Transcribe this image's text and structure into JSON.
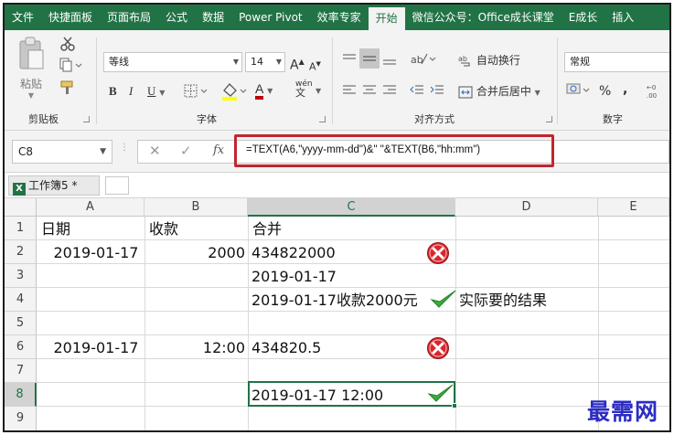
{
  "menu": {
    "tabs": [
      "文件",
      "快捷面板",
      "页面布局",
      "公式",
      "数据",
      "Power Pivot",
      "效率专家",
      "开始",
      "微信公众号：Office成长课堂",
      "E成长",
      "插入"
    ],
    "active_tab": "开始"
  },
  "ribbon": {
    "clipboard": {
      "paste_label": "粘贴",
      "group_label": "剪贴板"
    },
    "font": {
      "font_name": "等线",
      "font_size": "14",
      "grow": "A",
      "shrink": "A",
      "bold": "B",
      "italic": "I",
      "underline": "U",
      "pinyin": "wén",
      "group_label": "字体",
      "font_color": "#c00000",
      "highlight_color": "#ffff00"
    },
    "alignment": {
      "wrap_text": "自动换行",
      "merge_center": "合并后居中",
      "group_label": "对齐方式"
    },
    "number": {
      "format": "常规",
      "percent": "%",
      "comma": ",",
      "group_label": "数字"
    }
  },
  "formula_bar": {
    "name_box": "C8",
    "cancel": "✕",
    "enter": "✓",
    "fx": "fx",
    "formula": "=TEXT(A6,\"yyyy-mm-dd\")&\" \"&TEXT(B6,\"hh:mm\")",
    "highlight_color": "#c0272d"
  },
  "workbook": {
    "tab_label": "工作簿5 *",
    "icon": "X"
  },
  "grid": {
    "columns": [
      "A",
      "B",
      "C",
      "D",
      "E"
    ],
    "selected_column": "C",
    "rows": [
      "1",
      "2",
      "3",
      "4",
      "5",
      "6",
      "7",
      "8",
      "9"
    ],
    "selected_row": "8",
    "cells": {
      "A1": "日期",
      "B1": "收款",
      "C1": "合并",
      "A2": "2019-01-17",
      "B2": "2000",
      "C2": "434822000",
      "C3": "2019-01-17",
      "C4": "2019-01-17收款2000元",
      "D4": "实际要的结果",
      "A6": "2019-01-17",
      "B6": "12:00",
      "C6": "434820.5",
      "C8": "2019-01-17 12:00"
    },
    "active_cell": "C8",
    "marks": {
      "wrong_color": "#d9262c",
      "correct_color": "#3cab3c"
    }
  },
  "watermark": "最需网"
}
